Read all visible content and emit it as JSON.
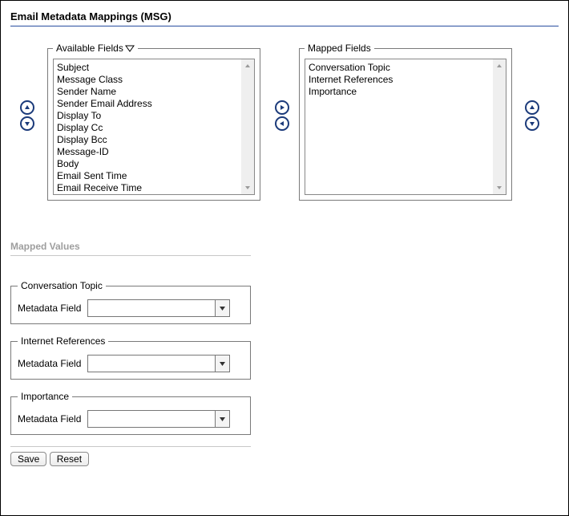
{
  "title": "Email Metadata Mappings (MSG)",
  "available": {
    "legend": "Available Fields",
    "items": [
      "Subject",
      "Message Class",
      "Sender Name",
      "Sender Email Address",
      "Display To",
      "Display Cc",
      "Display Bcc",
      "Message-ID",
      "Body",
      "Email Sent Time",
      "Email Receive Time"
    ]
  },
  "mapped": {
    "legend": "Mapped Fields",
    "items": [
      "Conversation Topic",
      "Internet References",
      "Importance"
    ]
  },
  "mapped_values": {
    "heading": "Mapped Values",
    "field_label": "Metadata Field",
    "groups": [
      {
        "legend": "Conversation Topic",
        "value": ""
      },
      {
        "legend": "Internet References",
        "value": ""
      },
      {
        "legend": "Importance",
        "value": ""
      }
    ]
  },
  "buttons": {
    "save": "Save",
    "reset": "Reset"
  }
}
